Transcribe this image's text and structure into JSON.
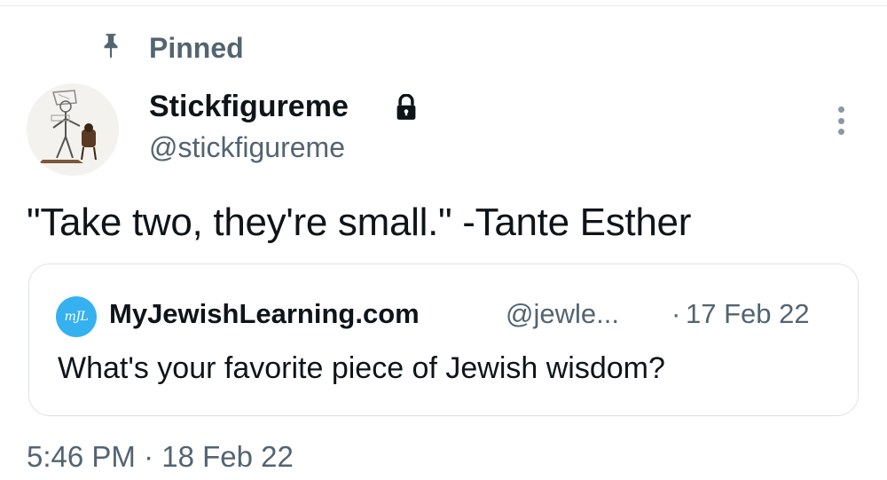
{
  "pinned": {
    "label": "Pinned",
    "icon": "pin-icon"
  },
  "author": {
    "display_name": "Stickfigureme",
    "handle": "@stickfigureme",
    "protected_icon": "lock-icon",
    "avatar": "stick-figure-avatar"
  },
  "tweet": {
    "text": "\"Take two, they're small.\" -Tante Esther",
    "more_icon": "more-options-icon"
  },
  "quote": {
    "avatar_text": "mJL",
    "avatar_color": "#35b1ef",
    "name": "MyJewishLearning.com",
    "handle": "@jewle...",
    "separator": "·",
    "date": "17 Feb 22",
    "text": "What's your favorite piece of Jewish wisdom?"
  },
  "meta": {
    "timestamp": "5:46 PM · 18 Feb 22"
  },
  "colors": {
    "text_primary": "#0f1419",
    "text_secondary": "#536471",
    "border": "#dfe3e6"
  }
}
